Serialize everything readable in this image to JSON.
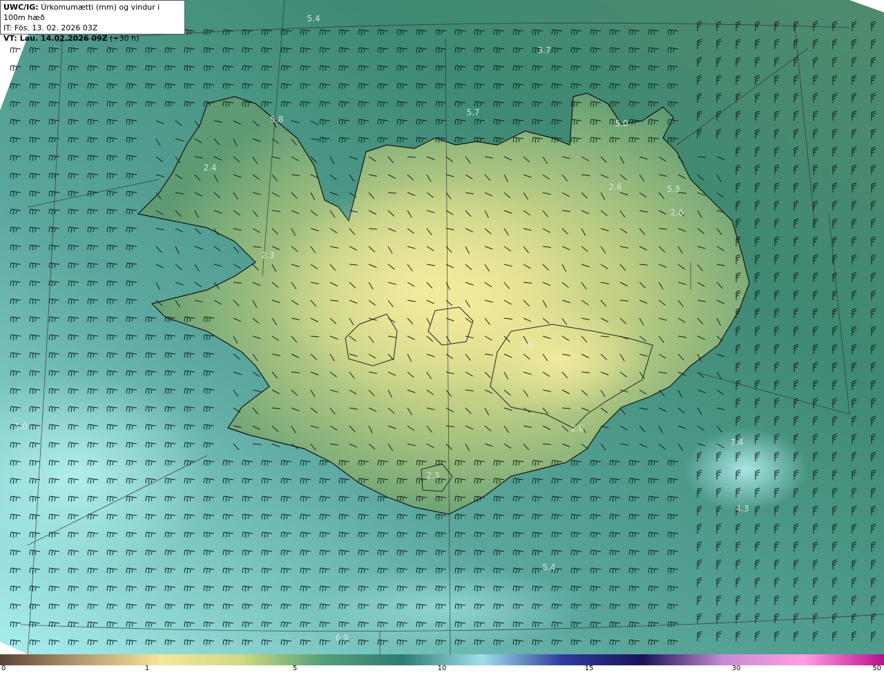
{
  "header": {
    "model_label": "UWC/IG:",
    "title": "Úrkomumætti (mm) og vindur i 100m hæð",
    "initial_time": "IT: Fös. 13. 02. 2026 03Z",
    "valid_label": "VT: Lau. 14.02.2026 09Z",
    "valid_offset": "(+30 h)"
  },
  "map_labels": [
    "5.4",
    "3.7",
    "5.7",
    "5.8",
    "5.0",
    "2.4",
    "2.6",
    "5.3",
    "2.6",
    "2.3",
    "1.0",
    "3.9",
    "2.3",
    "2.0",
    "7.4",
    "4.3",
    "5.4",
    "6.9"
  ],
  "colorbar": {
    "ticks": [
      "0",
      "1",
      "5",
      "10",
      "15",
      "30",
      "50"
    ],
    "stops": [
      "#5b4436",
      "#b59a70",
      "#f3e79a",
      "#cfd982",
      "#57a07a",
      "#2f7a76",
      "#9fe0e8",
      "#2f3b9f",
      "#1a1458",
      "#c78ad6",
      "#ff9ee0",
      "#b8108f"
    ]
  },
  "colors": {
    "sea_dark": "#2f6f68",
    "sea_light": "#9fe6ec",
    "land_low": "#6aa074",
    "land_high": "#efe493",
    "coast": "#111111",
    "barb": "#1a1a1a"
  }
}
